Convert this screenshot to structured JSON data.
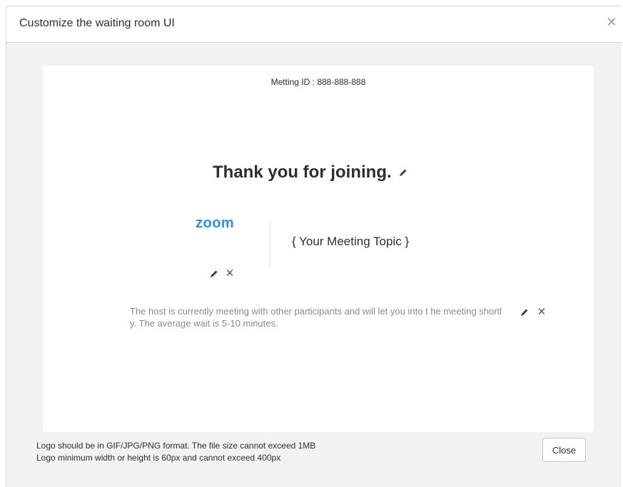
{
  "dialog": {
    "title": "Customize the waiting room UI",
    "close_icon": "close-icon"
  },
  "preview": {
    "meeting_id": "Metting ID : 888-888-888",
    "welcome_title": "Thank you for joining.",
    "logo_text": "zoom",
    "meeting_topic": "{ Your Meeting Topic }",
    "description": "The host is currently meeting with other participants and will let you into t he meeting shortly. The average wait is 5-10 minutes.",
    "edit_icon": "pencil-icon",
    "remove_icon": "close-icon",
    "remove_glyph": "✕"
  },
  "footer": {
    "note_line1": "Logo should be in GIF/JPG/PNG format. The file size cannot exceed 1MB",
    "note_line2": "Logo minimum width or height is 60px and cannot exceed 400px",
    "close_label": "Close"
  },
  "colors": {
    "zoom_blue": "#2d8cff",
    "text_dark": "#2d2d33",
    "text_muted": "#8a8a92",
    "dialog_bg": "#f2f2f4"
  }
}
